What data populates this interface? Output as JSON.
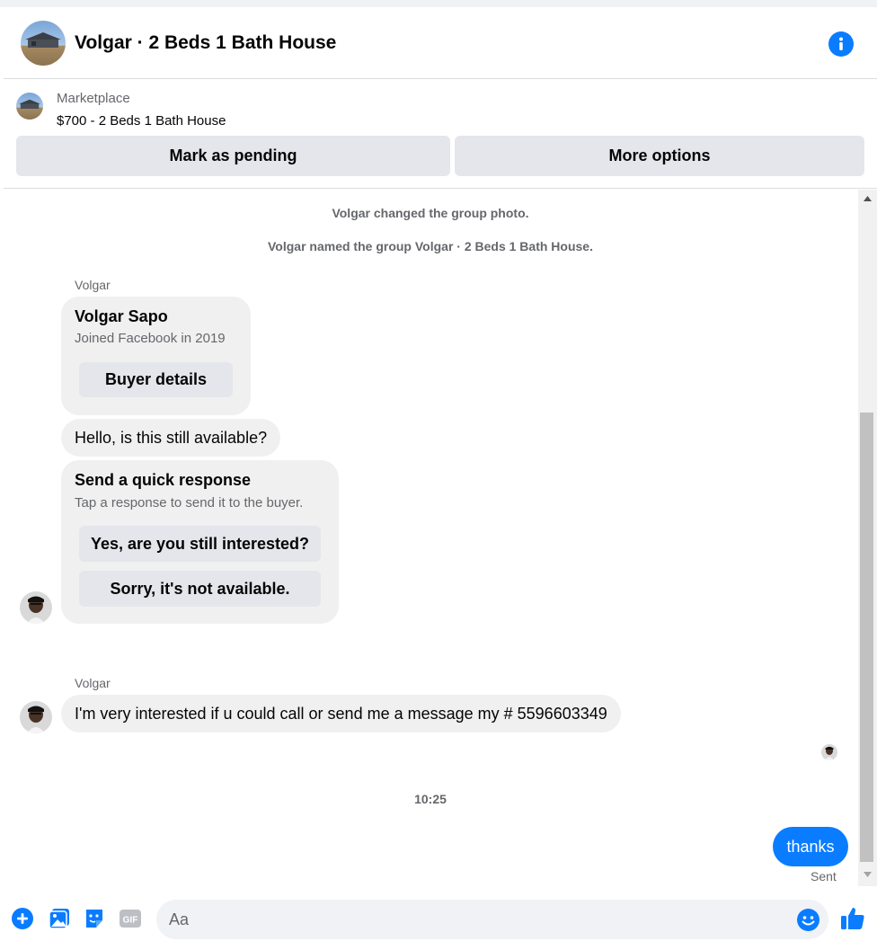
{
  "header": {
    "title": "Volgar · 2 Beds 1 Bath House",
    "info_icon": "info-icon"
  },
  "marketplace": {
    "label": "Marketplace",
    "listing": "$700 - 2 Beds 1 Bath House",
    "mark_pending_label": "Mark as pending",
    "more_options_label": "More options"
  },
  "thread": {
    "system_messages": [
      "Volgar changed the group photo.",
      "Volgar named the group Volgar · 2 Beds 1 Bath House."
    ],
    "group1": {
      "sender": "Volgar",
      "buyer_card": {
        "name": "Volgar Sapo",
        "joined": "Joined Facebook in 2019",
        "button_label": "Buyer details"
      },
      "message": "Hello, is this still available?",
      "quick_response": {
        "title": "Send a quick response",
        "subtitle": "Tap a response to send it to the buyer.",
        "options": [
          "Yes, are you still interested?",
          "Sorry, it's not available."
        ]
      }
    },
    "group2": {
      "sender": "Volgar",
      "message": "I'm very interested  if u could call or send me a message my # 5596603349"
    },
    "timestamp": "10:25",
    "my_message": "thanks",
    "status": "Sent"
  },
  "composer": {
    "placeholder": "Aa",
    "icons": [
      "plus-icon",
      "image-icon",
      "sticker-icon",
      "gif-icon",
      "emoji-icon",
      "thumbs-up-icon"
    ],
    "gif_label": "GIF"
  },
  "colors": {
    "accent": "#0a7cff",
    "bubble_gray": "#f0f0f0",
    "button_gray": "#e4e6eb",
    "secondary_text": "#65676b"
  }
}
